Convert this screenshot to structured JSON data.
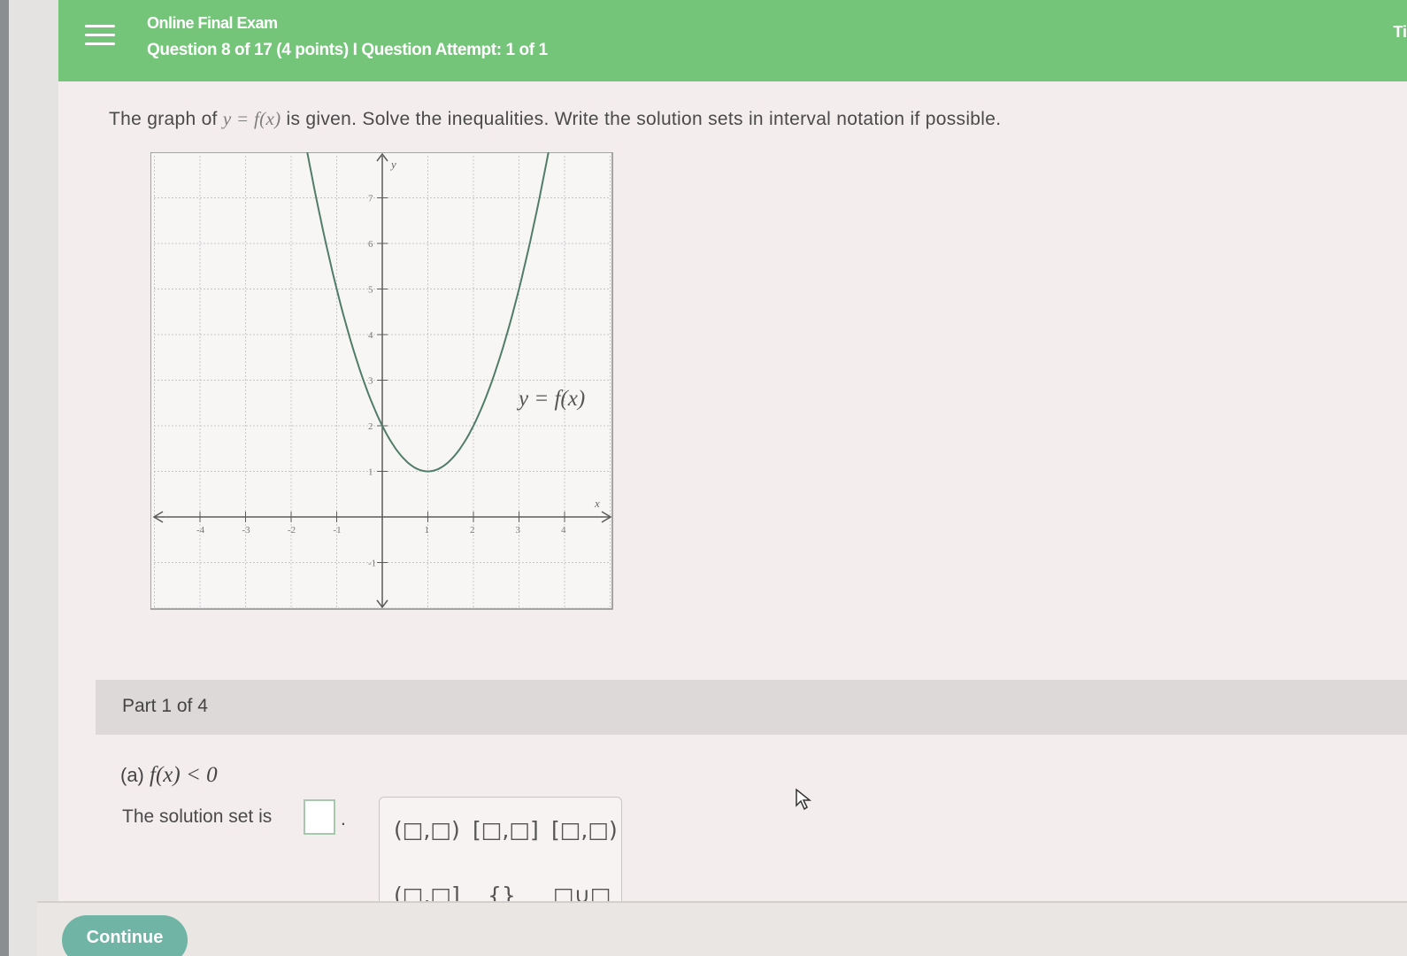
{
  "header": {
    "title": "Online Final Exam",
    "subtitle": "Question 8 of 17 (4 points) I Question Attempt: 1 of 1",
    "right_text": "Ti"
  },
  "question": {
    "prompt_pre": "The graph of",
    "prompt_math": "y = f(x)",
    "prompt_post": "is given. Solve the inequalities. Write the solution sets in interval notation if possible."
  },
  "graph": {
    "curve_label": "y = f(x)",
    "axis_x_label": "x",
    "axis_y_label": "y",
    "x_ticks": [
      "-4",
      "-3",
      "-2",
      "-1",
      "1",
      "2",
      "3",
      "4"
    ],
    "y_ticks": [
      "-1",
      "1",
      "2",
      "3",
      "4",
      "5",
      "6",
      "7"
    ],
    "curve_color": "#4f7d68"
  },
  "part": {
    "label": "Part 1 of 4"
  },
  "part_a": {
    "prefix": "(a)",
    "inequality": "f(x) < 0",
    "solution_label": "The solution set is",
    "solution_value": "",
    "period": "."
  },
  "palette": {
    "buttons": [
      "(□,□)",
      "[□,□]",
      "[□,□)",
      "(□,□]",
      "{}",
      "□∪□"
    ]
  },
  "footer": {
    "continue_label": "Continue"
  }
}
